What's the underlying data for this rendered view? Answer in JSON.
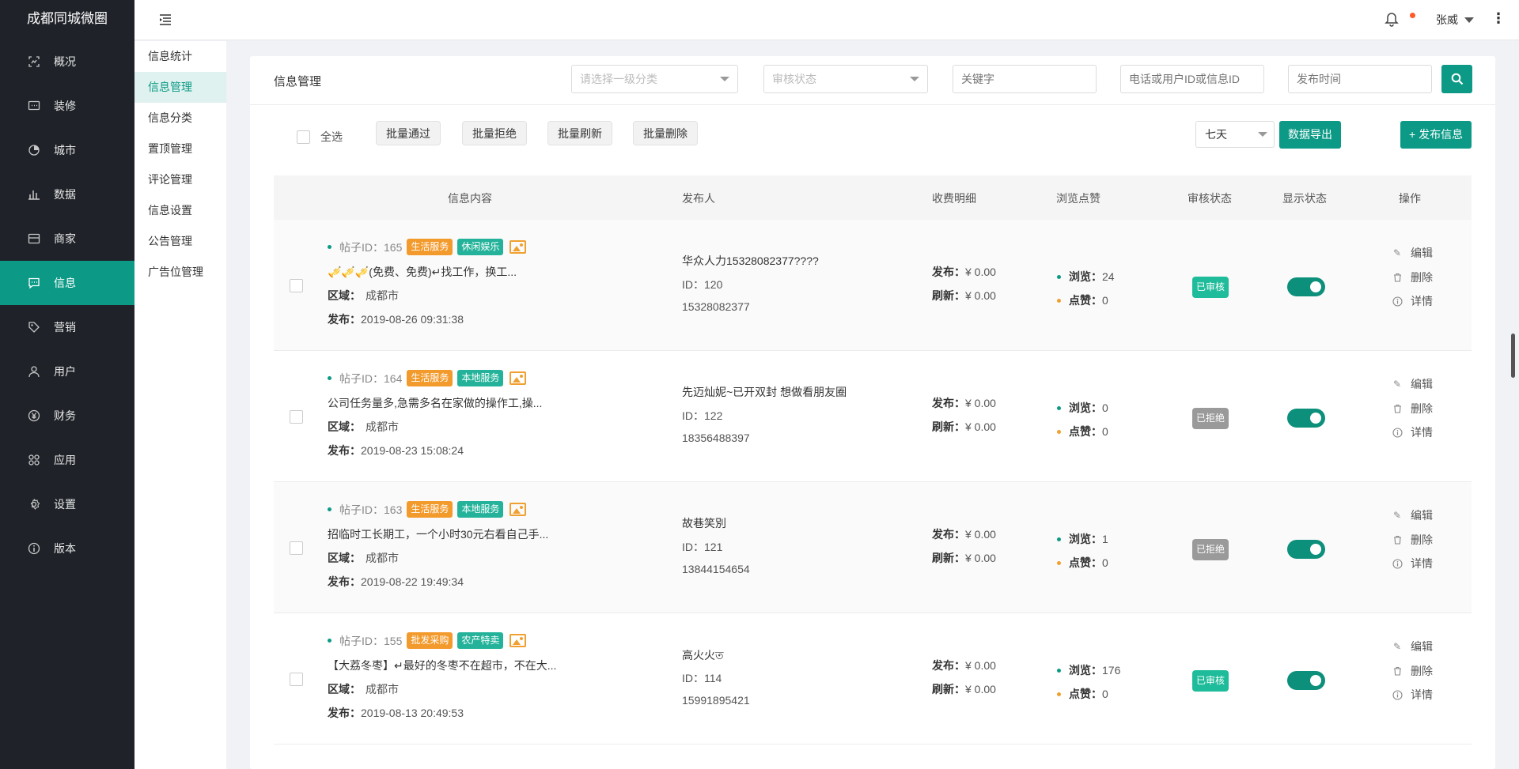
{
  "app": {
    "brand": "成都同城微圈"
  },
  "sidebar": {
    "items": [
      {
        "label": "概况",
        "icon": "overview-icon",
        "active": false
      },
      {
        "label": "装修",
        "icon": "decoration-icon",
        "active": false
      },
      {
        "label": "城市",
        "icon": "city-icon",
        "active": false
      },
      {
        "label": "数据",
        "icon": "data-icon",
        "active": false
      },
      {
        "label": "商家",
        "icon": "shop-icon",
        "active": false
      },
      {
        "label": "信息",
        "icon": "message-icon",
        "active": true
      },
      {
        "label": "营销",
        "icon": "tag-icon",
        "active": false
      },
      {
        "label": "用户",
        "icon": "user-icon",
        "active": false
      },
      {
        "label": "财务",
        "icon": "yen-icon",
        "active": false
      },
      {
        "label": "应用",
        "icon": "apps-icon",
        "active": false
      },
      {
        "label": "设置",
        "icon": "gear-icon",
        "active": false
      },
      {
        "label": "版本",
        "icon": "info-icon",
        "active": false
      }
    ]
  },
  "subnav": {
    "items": [
      {
        "label": "信息统计",
        "active": false
      },
      {
        "label": "信息管理",
        "active": true
      },
      {
        "label": "信息分类",
        "active": false
      },
      {
        "label": "置顶管理",
        "active": false
      },
      {
        "label": "评论管理",
        "active": false
      },
      {
        "label": "信息设置",
        "active": false
      },
      {
        "label": "公告管理",
        "active": false
      },
      {
        "label": "广告位管理",
        "active": false
      }
    ]
  },
  "topbar": {
    "user_name": "张威"
  },
  "main": {
    "title": "信息管理",
    "filters": {
      "category_placeholder": "请选择一级分类",
      "audit_placeholder": "审核状态",
      "keyword_placeholder": "关键字",
      "phone_placeholder": "电话或用户ID或信息ID",
      "time_placeholder": "发布时间"
    },
    "toolbar": {
      "select_all": "全选",
      "batch_pass": "批量通过",
      "batch_reject": "批量拒绝",
      "batch_refresh": "批量刷新",
      "batch_delete": "批量删除",
      "range": "七天",
      "export": "数据导出",
      "publish": "+ 发布信息"
    },
    "columns": [
      "信息内容",
      "发布人",
      "收费明细",
      "浏览点赞",
      "审核状态",
      "显示状态",
      "操作"
    ],
    "labels": {
      "post_id": "帖子ID：",
      "area": "区域：",
      "publish": "发布：",
      "fee_publish": "发布：",
      "fee_refresh": "刷新：",
      "views": "浏览：",
      "likes": "点赞：",
      "id": "ID：",
      "edit": "编辑",
      "delete": "删除",
      "detail": "详情"
    },
    "rows": [
      {
        "post_id": "165",
        "tags": [
          {
            "text": "生活服务",
            "color": "orange"
          },
          {
            "text": "休闲娱乐",
            "color": "teal"
          }
        ],
        "desc": "🎺🎺🎺(免费、免费)↵找工作，换工...",
        "area": "成都市",
        "time": "2019-08-26 09:31:38",
        "publisher": "华众人力15328082377????",
        "user_id": "120",
        "phone": "15328082377",
        "fee_publish": "¥ 0.00",
        "fee_refresh": "¥ 0.00",
        "views": "24",
        "likes": "0",
        "audit": "已审核",
        "audit_ok": true,
        "display_on": true
      },
      {
        "post_id": "164",
        "tags": [
          {
            "text": "生活服务",
            "color": "orange"
          },
          {
            "text": "本地服务",
            "color": "teal"
          }
        ],
        "desc": "公司任务量多,急需多名在家做的操作工,操...",
        "area": "成都市",
        "time": "2019-08-23 15:08:24",
        "publisher": "先迈灿妮~已开双封 想做看朋友圈",
        "user_id": "122",
        "phone": "18356488397",
        "fee_publish": "¥ 0.00",
        "fee_refresh": "¥ 0.00",
        "views": "0",
        "likes": "0",
        "audit": "已拒绝",
        "audit_ok": false,
        "display_on": true
      },
      {
        "post_id": "163",
        "tags": [
          {
            "text": "生活服务",
            "color": "orange"
          },
          {
            "text": "本地服务",
            "color": "teal"
          }
        ],
        "desc": "招临时工长期工，一个小时30元右看自己手...",
        "area": "成都市",
        "time": "2019-08-22 19:49:34",
        "publisher": "故巷笑別",
        "user_id": "121",
        "phone": "13844154654",
        "fee_publish": "¥ 0.00",
        "fee_refresh": "¥ 0.00",
        "views": "1",
        "likes": "0",
        "audit": "已拒绝",
        "audit_ok": false,
        "display_on": true
      },
      {
        "post_id": "155",
        "tags": [
          {
            "text": "批发采购",
            "color": "orange"
          },
          {
            "text": "农产特卖",
            "color": "teal"
          }
        ],
        "desc": "【大荔冬枣】↵最好的冬枣不在超市，不在大...",
        "area": "成都市",
        "time": "2019-08-13 20:49:53",
        "publisher": "高火火ত",
        "user_id": "114",
        "phone": "15991895421",
        "fee_publish": "¥ 0.00",
        "fee_refresh": "¥ 0.00",
        "views": "176",
        "likes": "0",
        "audit": "已审核",
        "audit_ok": true,
        "display_on": true
      }
    ]
  },
  "colors": {
    "primary": "#0c9a86",
    "sidebar_bg": "#1f2329",
    "tag_orange": "#f39a2c",
    "tag_teal": "#24b39a",
    "status_ok": "#1ebc9a",
    "status_rejected": "#9a9a9a"
  }
}
